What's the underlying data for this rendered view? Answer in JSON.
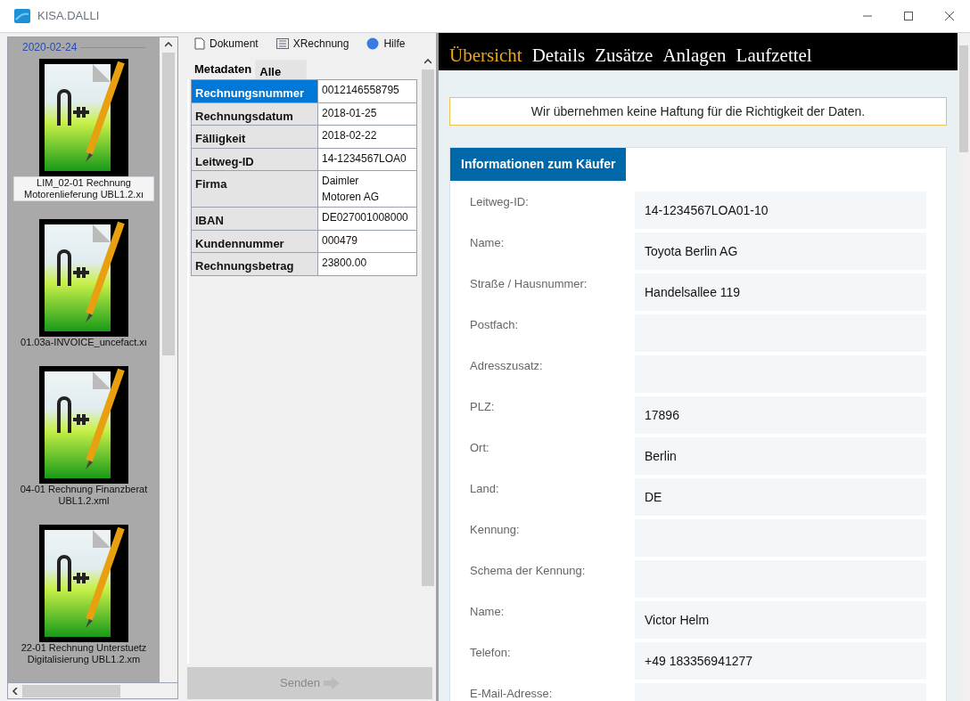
{
  "window": {
    "title": "KISA.DALLI"
  },
  "sidebar": {
    "date": "2020-02-24",
    "items": [
      {
        "label": "LIM_02-01 Rechnung Motorenlieferung UBL1.2.xı",
        "selected": true
      },
      {
        "label": "01.03a-INVOICE_uncefact.xı",
        "selected": false
      },
      {
        "label": "04-01 Rechnung Finanzberat UBL1.2.xml",
        "selected": false
      },
      {
        "label": "22-01 Rechnung Unterstuetz Digitalisierung UBL1.2.xm",
        "selected": false
      }
    ]
  },
  "toolbar": [
    {
      "kind": "document",
      "label": "Dokument"
    },
    {
      "kind": "list",
      "label": "XRechnung"
    },
    {
      "kind": "help",
      "label": "Hilfe"
    }
  ],
  "meta_tabs": [
    {
      "label": "Metadaten",
      "selected": true
    },
    {
      "label": "Alle",
      "selected": false
    }
  ],
  "meta_rows": [
    {
      "key": "Rechnungsnummer",
      "value": "0012146558795",
      "selected": true
    },
    {
      "key": "Rechnungsdatum",
      "value": "2018-01-25",
      "selected": false
    },
    {
      "key": "Fälligkeit",
      "value": "2018-02-22",
      "selected": false
    },
    {
      "key": "Leitweg-ID",
      "value": "14-1234567LOA0",
      "selected": false
    },
    {
      "key": "Firma",
      "value": "Daimler Motoren AG",
      "selected": false
    },
    {
      "key": "IBAN",
      "value": "DE027001008000",
      "selected": false
    },
    {
      "key": "Kundennummer",
      "value": "000479",
      "selected": false
    },
    {
      "key": "Rechnungsbetrag",
      "value": "23800.00",
      "selected": false
    }
  ],
  "send_button": {
    "label": "Senden",
    "disabled": true
  },
  "nav_tabs": [
    {
      "label": "Übersicht",
      "selected": true
    },
    {
      "label": "Details",
      "selected": false
    },
    {
      "label": "Zusätze",
      "selected": false
    },
    {
      "label": "Anlagen",
      "selected": false
    },
    {
      "label": "Laufzettel",
      "selected": false
    }
  ],
  "notice": "Wir übernehmen keine Haftung für die Richtigkeit der Daten.",
  "section": {
    "title": "Informationen zum Käufer",
    "fields": [
      {
        "label": "Leitweg-ID:",
        "value": "14-1234567LOA01-10"
      },
      {
        "label": "Name:",
        "value": "Toyota Berlin AG"
      },
      {
        "label": "Straße / Hausnummer:",
        "value": "Handelsallee 119"
      },
      {
        "label": "Postfach:"
      },
      {
        "label": "Adresszusatz:"
      },
      {
        "label": "PLZ:",
        "value": "17896"
      },
      {
        "label": "Ort:",
        "value": "Berlin"
      },
      {
        "label": "Land:",
        "value": "DE"
      },
      {
        "label": "Kennung:"
      },
      {
        "label": "Schema der Kennung:"
      },
      {
        "label": "Name:",
        "value": "Victor Helm"
      },
      {
        "label": "Telefon:",
        "value": "+49 183356941277"
      },
      {
        "label": "E-Mail-Adresse:"
      }
    ]
  }
}
